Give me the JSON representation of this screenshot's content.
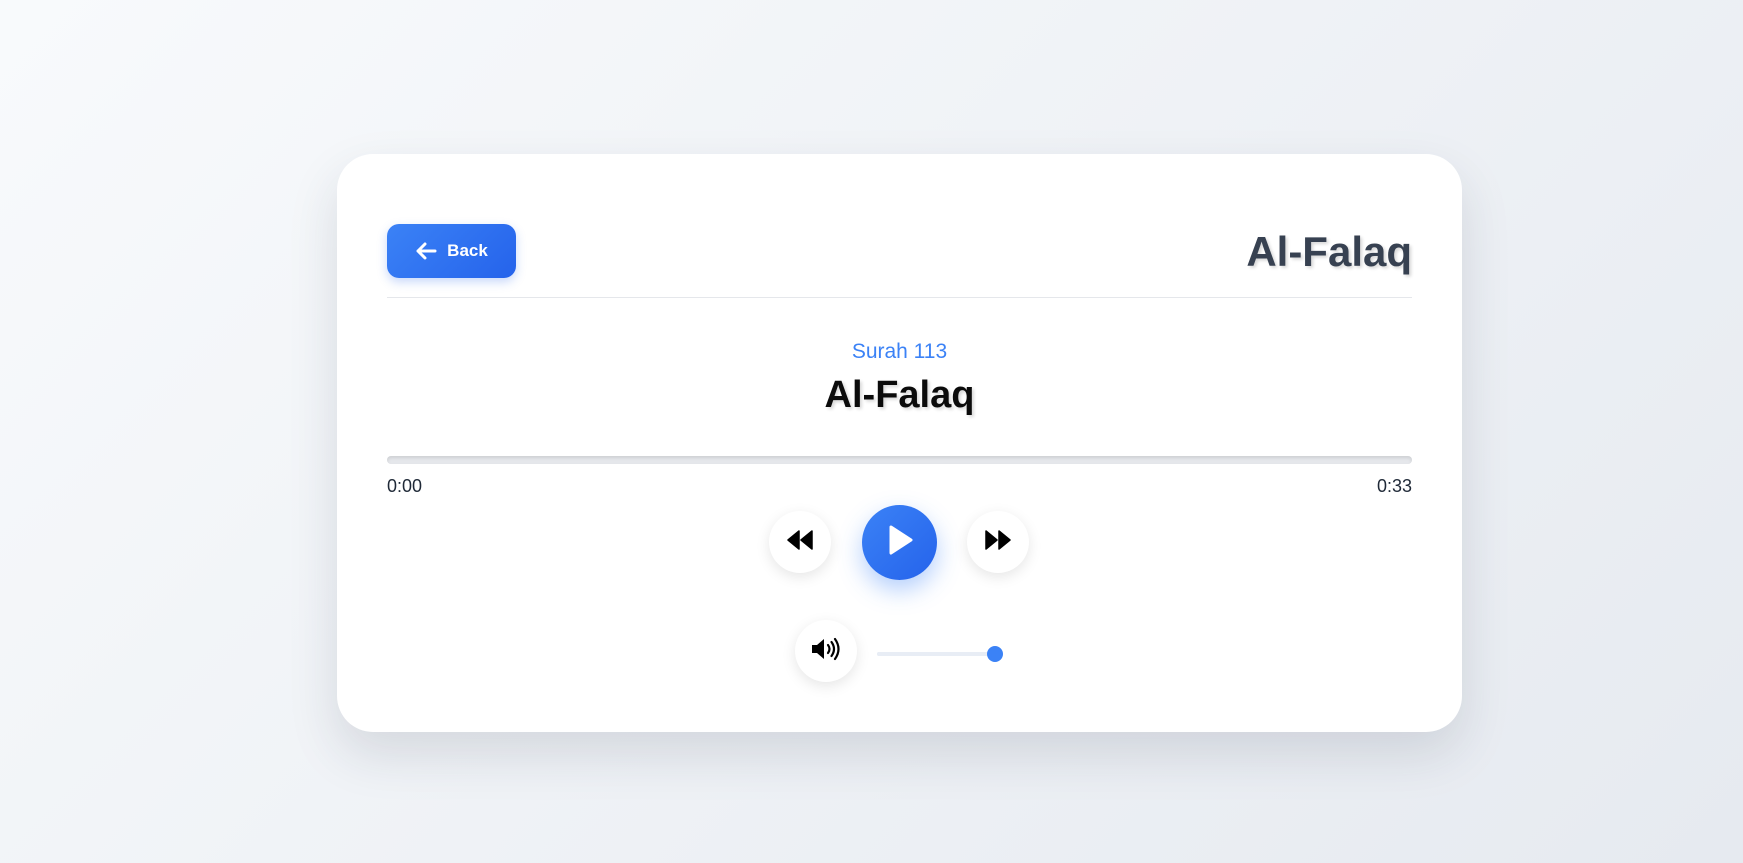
{
  "header": {
    "back_label": "Back",
    "title": "Al-Falaq"
  },
  "track": {
    "surah_number": "Surah 113",
    "surah_name": "Al-Falaq"
  },
  "progress": {
    "current_time": "0:00",
    "total_time": "0:33",
    "fraction": 0
  },
  "controls": {
    "rewind_icon": "rewind-icon",
    "play_icon": "play-icon",
    "forward_icon": "fast-forward-icon",
    "volume_icon": "volume-high-icon"
  },
  "volume": {
    "level": 1.0
  },
  "colors": {
    "accent": "#3b82f6",
    "accent_dark": "#2563eb",
    "title": "#374151",
    "text": "#1f2937"
  }
}
